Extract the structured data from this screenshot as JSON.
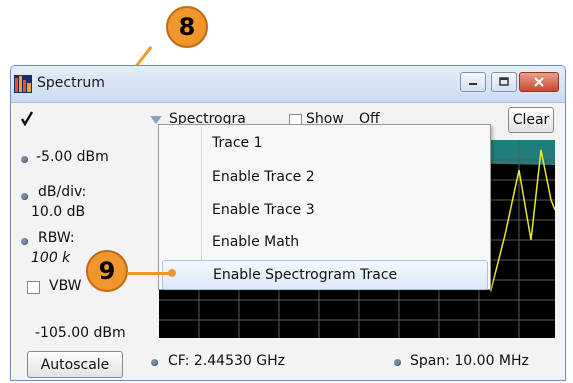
{
  "callouts": {
    "top": "8",
    "left": "9"
  },
  "window": {
    "title": "Spectrum",
    "icon": "spectrum-app-icon",
    "controls": [
      "minimize-icon",
      "maximize-icon",
      "close-icon"
    ]
  },
  "toolbar": {
    "check_icon": "checkmark-icon",
    "dropdown_icon": "triangle-down-icon",
    "trace_select": "Spectrogra",
    "show_label": "Show",
    "show_value": "Off",
    "clear_label": "Clear"
  },
  "side_panel": {
    "ref_level": "-5.00 dBm",
    "db_div_label": "dB/div:",
    "db_div_value": "10.0 dB",
    "rbw_label": "RBW:",
    "rbw_value": "100 k",
    "vbw_label": "VBW",
    "bottom_level": "-105.00 dBm",
    "autoscale_label": "Autoscale"
  },
  "bottom_bar": {
    "cf_label": "CF: 2.44530 GHz",
    "span_label": "Span: 10.00 MHz"
  },
  "context_menu": {
    "items": [
      {
        "label": "Trace 1",
        "highlighted": false
      },
      {
        "label": "Enable Trace 2",
        "highlighted": false
      },
      {
        "label": "Enable Trace 3",
        "highlighted": false
      },
      {
        "label": "Enable Math",
        "highlighted": false
      },
      {
        "label": "Enable Spectrogram Trace",
        "highlighted": true
      }
    ]
  },
  "colors": {
    "callout": "#f0962c",
    "plot_background": "#000000",
    "trace": "#e8e830",
    "spectrogram_band": "#1f7d7a",
    "grid": "#5a5a5a"
  }
}
